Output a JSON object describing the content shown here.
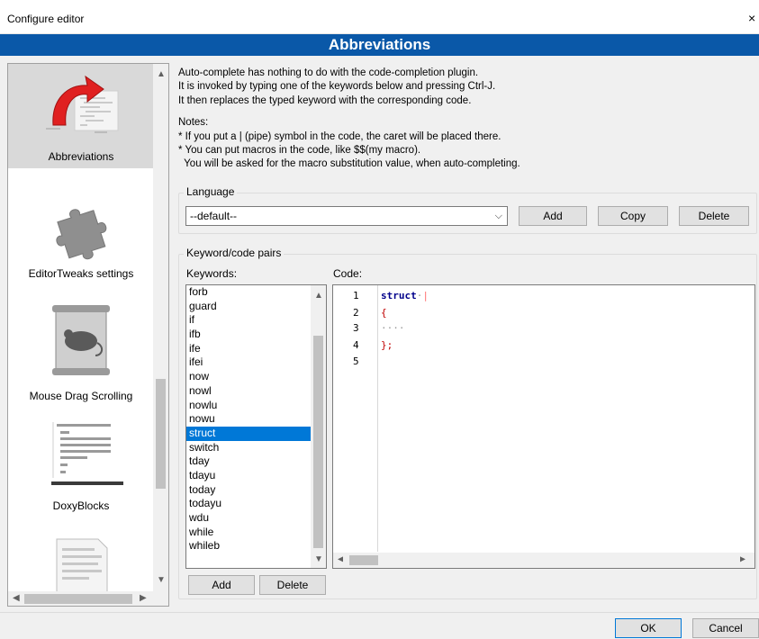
{
  "window": {
    "title": "Configure editor",
    "close_glyph": "×"
  },
  "header": {
    "title": "Abbreviations"
  },
  "sidebar": {
    "items": [
      {
        "label": "Abbreviations",
        "icon": "abbreviations-icon",
        "selected": true
      },
      {
        "label": "EditorTweaks settings",
        "icon": "puzzle-icon",
        "selected": false
      },
      {
        "label": "Mouse Drag Scrolling",
        "icon": "mouse-scroll-icon",
        "selected": false
      },
      {
        "label": "DoxyBlocks",
        "icon": "doxyblocks-icon",
        "selected": false
      },
      {
        "label": "",
        "icon": "document-icon",
        "selected": false
      }
    ]
  },
  "intro": {
    "lines": [
      "Auto-complete has nothing to do with the code-completion plugin.",
      "It is invoked by typing one of the keywords below and pressing Ctrl-J.",
      "It then replaces the typed keyword with the corresponding code."
    ],
    "notes_title": "Notes:",
    "notes": [
      "* If you put a | (pipe) symbol in the code, the caret will be placed there.",
      "* You can put macros in the code, like $$(my macro).",
      "  You will be asked for the macro substitution value, when auto-completing."
    ]
  },
  "language": {
    "group_label": "Language",
    "selected": "--default--",
    "add_label": "Add",
    "copy_label": "Copy",
    "delete_label": "Delete"
  },
  "pairs": {
    "group_label": "Keyword/code pairs",
    "keywords_label": "Keywords:",
    "code_label": "Code:",
    "keywords": [
      "forb",
      "guard",
      "if",
      "ifb",
      "ife",
      "ifei",
      "now",
      "nowl",
      "nowlu",
      "nowu",
      "struct",
      "switch",
      "tday",
      "tdayu",
      "today",
      "todayu",
      "wdu",
      "while",
      "whileb"
    ],
    "selected_keyword": "struct",
    "add_label": "Add",
    "delete_label": "Delete"
  },
  "code": {
    "line_numbers": [
      "1",
      "2",
      "3",
      "4",
      "5"
    ],
    "line1_keyword": "struct",
    "line1_space": "·",
    "line1_caret": "|",
    "line2": "{",
    "line3": "····",
    "line4_brace": "}",
    "line4_semi": ";"
  },
  "dialog": {
    "ok_label": "OK",
    "cancel_label": "Cancel"
  },
  "colors": {
    "header_band": "#0a58a8",
    "selection": "#0078d7",
    "code_keyword": "#00008b",
    "code_operator": "#c00000"
  }
}
